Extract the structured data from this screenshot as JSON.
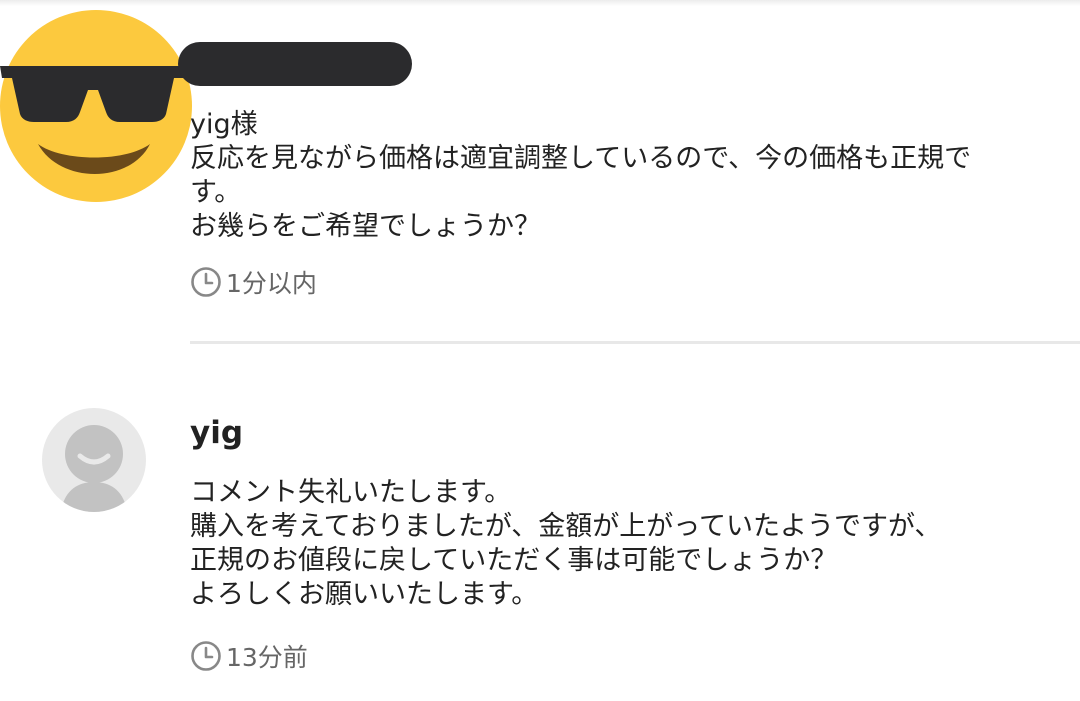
{
  "comments": [
    {
      "avatar": "sunglasses-emoji-avatar",
      "username": "",
      "message_lines": [
        "yig様",
        "反応を見ながら価格は適宜調整しているので、今の価格も正規で",
        "す。",
        "お幾らをご希望でしょうか？"
      ],
      "time_icon": "clock-icon",
      "time": "1分以内"
    },
    {
      "avatar": "default-user-avatar",
      "username": "yig",
      "message_lines": [
        "コメント失礼いたします。",
        "購入を考えておりましたが、金額が上がっていたようですが、",
        "正規のお値段に戻していただく事は可能でしょうか？",
        "よろしくお願いいたします。"
      ],
      "time_icon": "clock-icon",
      "time": "13分前"
    }
  ],
  "colors": {
    "emoji_face": "#FCC93E",
    "sunglasses": "#2B2B2D",
    "mouth": "#6B4A1A",
    "default_avatar_bg": "#E9E9E9",
    "default_avatar_fg": "#C2C2C2",
    "redaction": "#2B2B2D",
    "timestamp_text": "#666666",
    "divider": "#E8E8E8"
  }
}
